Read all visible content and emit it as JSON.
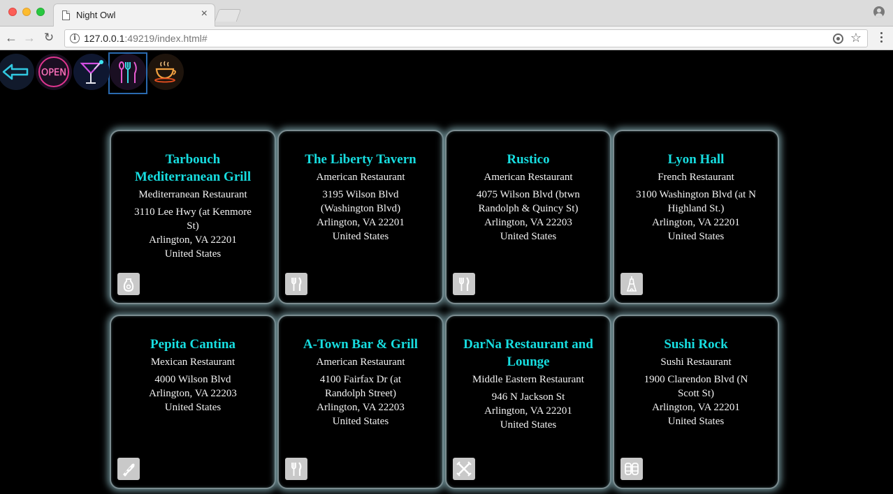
{
  "browser": {
    "tab_title": "Night Owl",
    "tab_close": "×",
    "url_host": "127.0.0.1",
    "url_rest": ":49219/index.html#",
    "info_glyph": "i",
    "star_glyph": "☆",
    "back_glyph": "←",
    "forward_glyph": "→",
    "reload_glyph": "↻"
  },
  "categories": [
    {
      "name": "back",
      "icon": "back-arrow-icon"
    },
    {
      "name": "open",
      "icon": "open-sign-icon",
      "label": "OPEN"
    },
    {
      "name": "bars",
      "icon": "cocktail-icon"
    },
    {
      "name": "restaurants",
      "icon": "fork-spoon-knife-icon",
      "selected": true
    },
    {
      "name": "coffee",
      "icon": "coffee-cup-icon"
    }
  ],
  "restaurants": [
    {
      "name": "Tarbouch Mediterranean Grill",
      "type": "Mediterranean Restaurant",
      "address": [
        "3110 Lee Hwy (at Kenmore St)",
        "Arlington, VA 22201",
        "United States"
      ],
      "icon": "falafel-icon"
    },
    {
      "name": "The Liberty Tavern",
      "type": "American Restaurant",
      "address": [
        "3195 Wilson Blvd (Washington Blvd)",
        "Arlington, VA 22201",
        "United States"
      ],
      "icon": "fork-knife-icon"
    },
    {
      "name": "Rustico",
      "type": "American Restaurant",
      "address": [
        "4075 Wilson Blvd (btwn Randolph & Quincy St)",
        "Arlington, VA 22203",
        "United States"
      ],
      "icon": "fork-knife-icon"
    },
    {
      "name": "Lyon Hall",
      "type": "French Restaurant",
      "address": [
        "3100 Washington Blvd (at N Highland St.)",
        "Arlington, VA 22201",
        "United States"
      ],
      "icon": "eiffel-tower-icon"
    },
    {
      "name": "Pepita Cantina",
      "type": "Mexican Restaurant",
      "address": [
        "4000 Wilson Blvd",
        "Arlington, VA 22203",
        "United States"
      ],
      "icon": "burrito-icon"
    },
    {
      "name": "A-Town Bar & Grill",
      "type": "American Restaurant",
      "address": [
        "4100 Fairfax Dr (at Randolph Street)",
        "Arlington, VA 22203",
        "United States"
      ],
      "icon": "fork-knife-icon"
    },
    {
      "name": "DarNa Restaurant and Lounge",
      "type": "Middle Eastern Restaurant",
      "address": [
        "946 N Jackson St",
        "Arlington, VA 22201",
        "United States"
      ],
      "icon": "crossed-utensils-icon"
    },
    {
      "name": "Sushi Rock",
      "type": "Sushi Restaurant",
      "address": [
        "1900 Clarendon Blvd (N Scott St)",
        "Arlington, VA 22201",
        "United States"
      ],
      "icon": "sushi-icon"
    }
  ],
  "colors": {
    "title": "#17dde0",
    "card_glow": "#6a8a90",
    "selected_border": "#2a6aaf"
  }
}
